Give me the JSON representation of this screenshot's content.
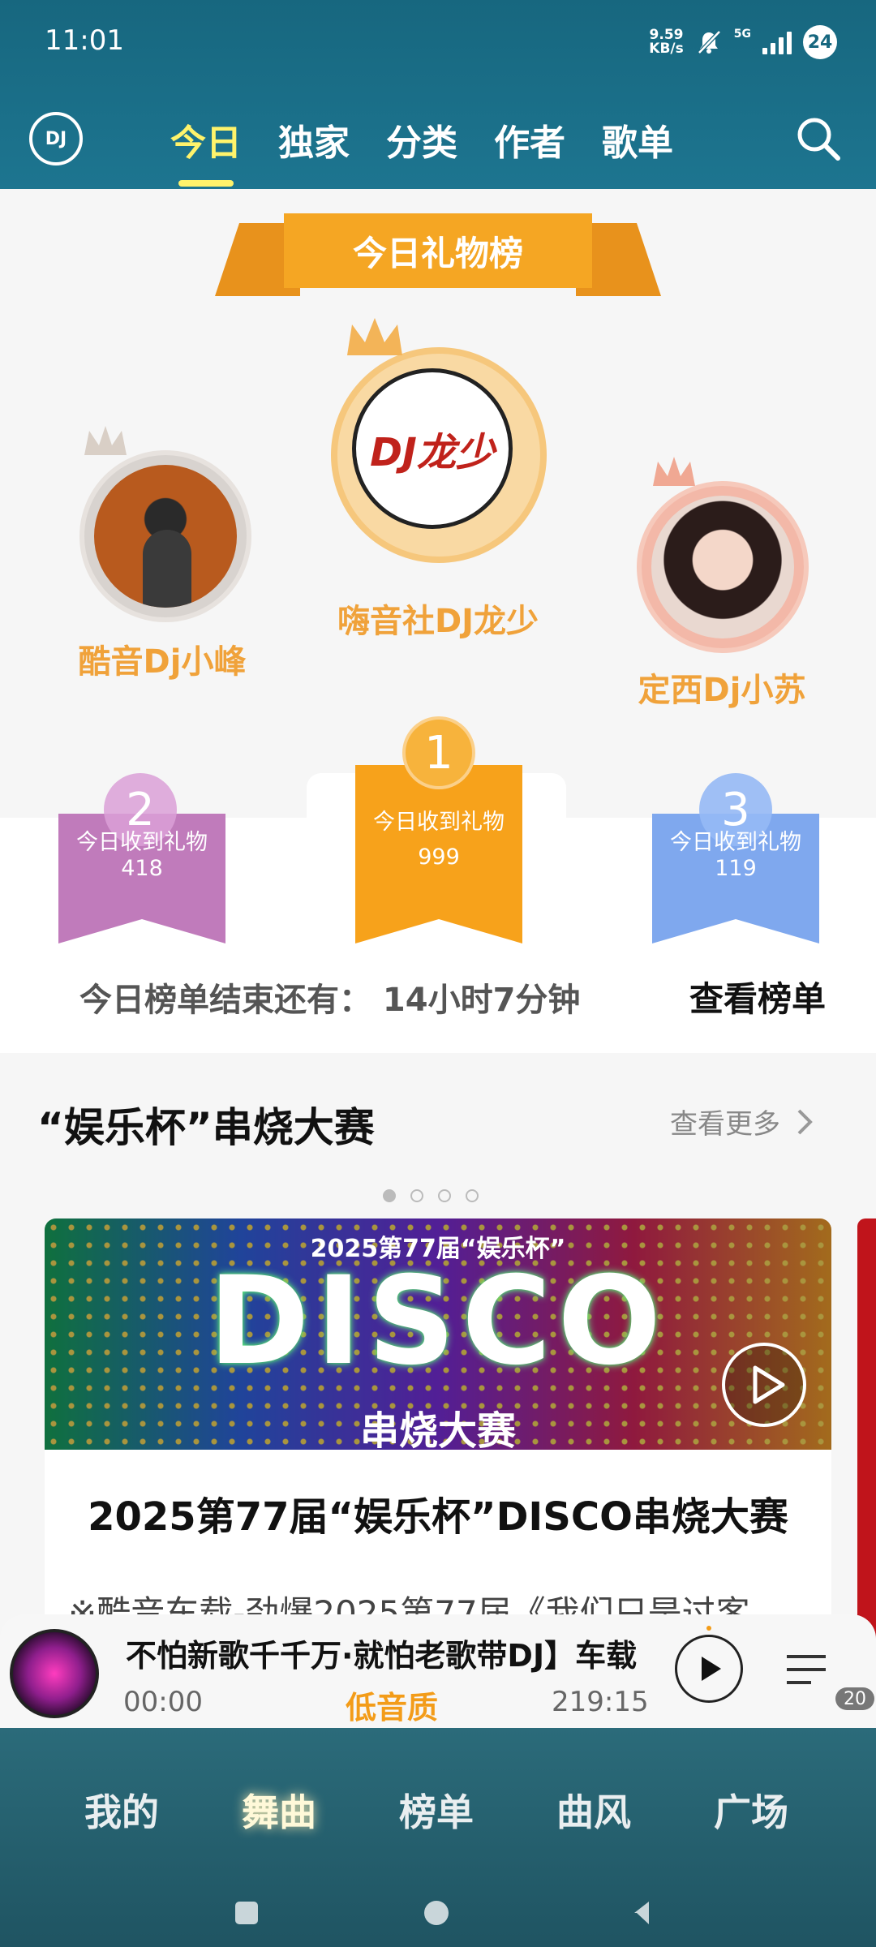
{
  "status": {
    "time": "11:01",
    "net_speed": "9.59",
    "net_unit": "KB/s",
    "network": "5G",
    "battery": "24"
  },
  "header": {
    "logo": "DJ",
    "tabs": [
      {
        "label": "今日",
        "active": true
      },
      {
        "label": "独家",
        "active": false
      },
      {
        "label": "分类",
        "active": false
      },
      {
        "label": "作者",
        "active": false
      },
      {
        "label": "歌单",
        "active": false
      }
    ]
  },
  "gifts": {
    "title": "今日礼物榜",
    "top1": {
      "name": "嗨音社DJ龙少",
      "rank": "1",
      "label": "今日收到礼物",
      "count": "999",
      "avatar_text": "DJ龙少"
    },
    "top2": {
      "name": "酷音Dj小峰",
      "rank": "2",
      "label": "今日收到礼物",
      "count": "418"
    },
    "top3": {
      "name": "定西Dj小苏",
      "rank": "3",
      "label": "今日收到礼物",
      "count": "119"
    },
    "countdown": "今日榜单结束还有： 14小时7分钟",
    "view_link": "查看榜单"
  },
  "contest": {
    "title": "“娱乐杯”串烧大赛",
    "more": "查看更多",
    "banner_top": "2025第77届“娱乐杯”",
    "banner_main": "DISCO",
    "banner_sub": "串烧大赛",
    "card_title": "2025第77届“娱乐杯”DISCO串烧大赛",
    "card_desc": "※酷音车载-劲爆2025第77届《我们只是过客…"
  },
  "player": {
    "song": "不怕新歌千千万·就怕老歌带DJ】车载",
    "current": "00:00",
    "quality": "低音质",
    "total": "219:15",
    "queue_count": "20"
  },
  "nav": [
    {
      "label": "我的",
      "active": false
    },
    {
      "label": "舞曲",
      "active": true
    },
    {
      "label": "榜单",
      "active": false
    },
    {
      "label": "曲风",
      "active": false
    },
    {
      "label": "广场",
      "active": false
    }
  ],
  "colors": {
    "header": "#17677f",
    "accent": "#fff36b",
    "gold": "#f39c19",
    "rank2": "#c07bbb",
    "rank3": "#7fa8ee"
  }
}
